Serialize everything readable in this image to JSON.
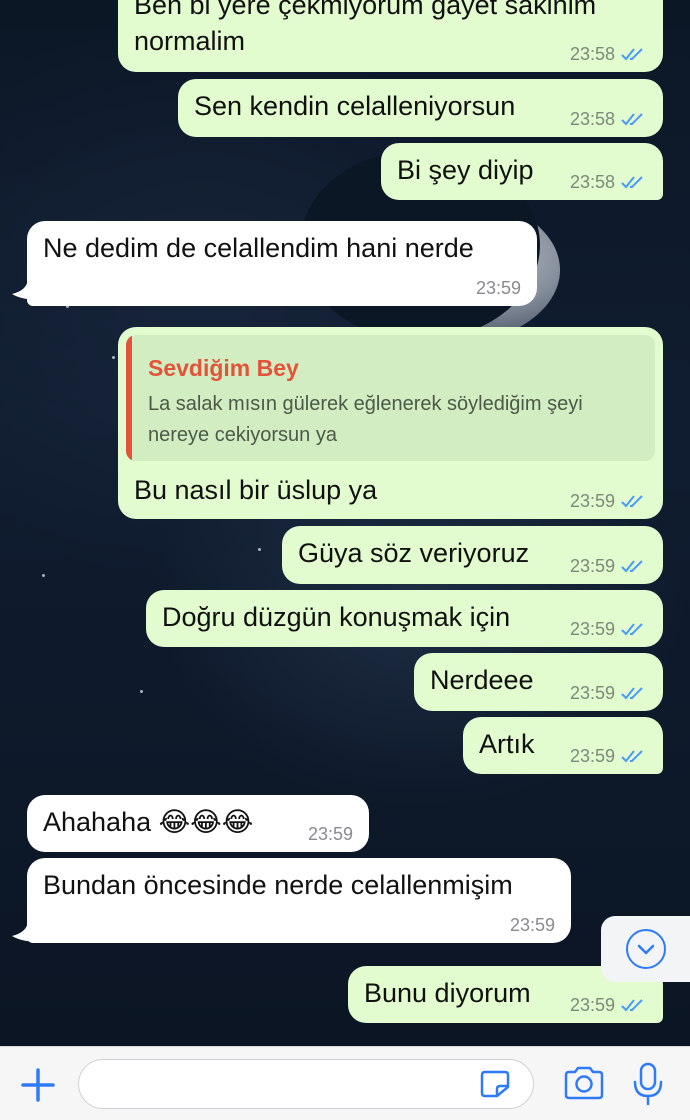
{
  "colors": {
    "outgoing_bubble": "#e2fbcf",
    "incoming_bubble": "#ffffff",
    "read_ticks": "#4b9af5",
    "quote_accent": "#e2533a",
    "accent": "#2f7bf5"
  },
  "messages": [
    {
      "direction": "out",
      "text": "Ben bi yere çekmiyorum gayet sakinim",
      "text2": "normalim",
      "time": "23:58",
      "status": "read"
    },
    {
      "direction": "out",
      "text": "Sen kendin celalleniyorsun",
      "time": "23:58",
      "status": "read"
    },
    {
      "direction": "out",
      "text": "Bi şey diyip",
      "time": "23:58",
      "status": "read"
    },
    {
      "direction": "in",
      "text": "Ne dedim de celallendim hani nerde",
      "time": "23:59"
    },
    {
      "direction": "out",
      "text": "Bu nasıl bir üslup ya",
      "time": "23:59",
      "status": "read",
      "reply_to": {
        "author": "Sevdiğim Bey",
        "text": "La salak mısın gülerek eğlenerek söylediğim şeyi nereye cekiyorsun ya"
      }
    },
    {
      "direction": "out",
      "text": "Güya söz veriyoruz",
      "time": "23:59",
      "status": "read"
    },
    {
      "direction": "out",
      "text": "Doğru düzgün konuşmak için",
      "time": "23:59",
      "status": "read"
    },
    {
      "direction": "out",
      "text": "Nerdeee",
      "time": "23:59",
      "status": "read"
    },
    {
      "direction": "out",
      "text": "Artık",
      "time": "23:59",
      "status": "read"
    },
    {
      "direction": "in",
      "text": "Ahahaha 😂😂😂",
      "time": "23:59"
    },
    {
      "direction": "in",
      "text": "Bundan öncesinde nerde celallenmişim",
      "time": "23:59"
    },
    {
      "direction": "out",
      "text": "Bunu diyorum",
      "time": "23:59",
      "status": "read"
    }
  ],
  "scroll_down": {
    "icon": "chevron-down-icon"
  },
  "composer": {
    "plus_icon": "plus-icon",
    "input_value": "",
    "input_placeholder": "",
    "sticker_icon": "sticker-icon",
    "camera_icon": "camera-icon",
    "mic_icon": "microphone-icon"
  }
}
